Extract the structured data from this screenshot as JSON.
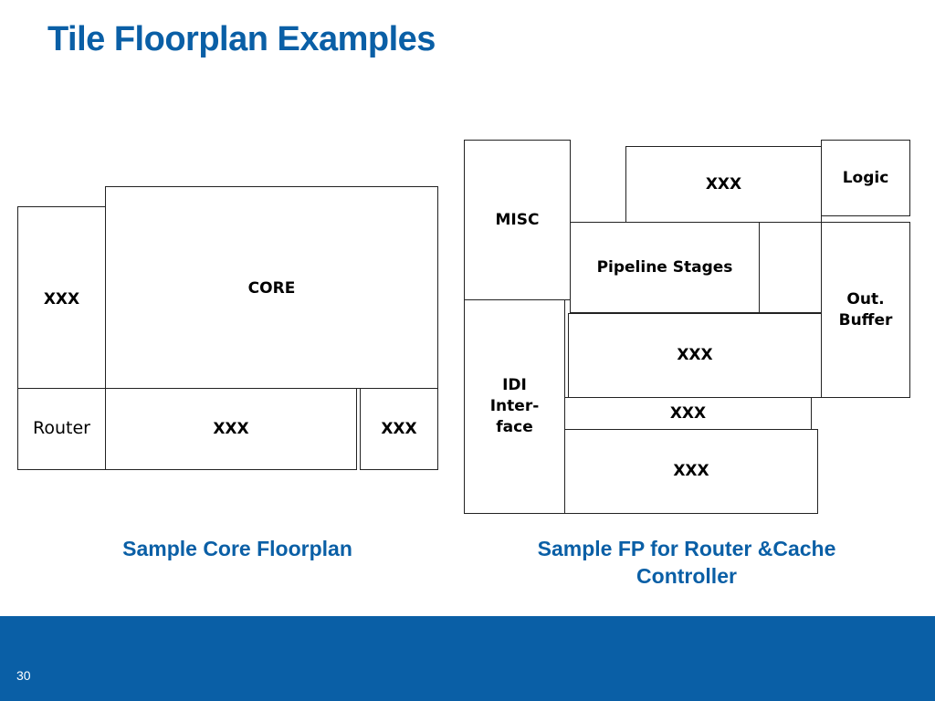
{
  "slide": {
    "title": "Tile Floorplan Examples",
    "page_number": "30"
  },
  "core_floorplan": {
    "caption": "Sample Core Floorplan",
    "blocks": {
      "left_xxx": "XXX",
      "core": "CORE",
      "router": "Router",
      "bottom_xxx": "XXX",
      "bottom_right_xxx": "XXX"
    }
  },
  "router_cache_floorplan": {
    "caption": "Sample FP for Router &Cache\nController",
    "blocks": {
      "misc": "MISC",
      "top_xxx": "XXX",
      "logic": "Logic",
      "pipeline_stages": "Pipeline Stages",
      "out_buffer": "Out.\nBuffer",
      "idi_interface": "IDI\nInter-\nface",
      "mid_xxx": "XXX",
      "thin_xxx": "XXX",
      "bottom_xxx": "XXX"
    }
  },
  "colors": {
    "accent": "#0a5fa6",
    "box_border": "#222222"
  }
}
